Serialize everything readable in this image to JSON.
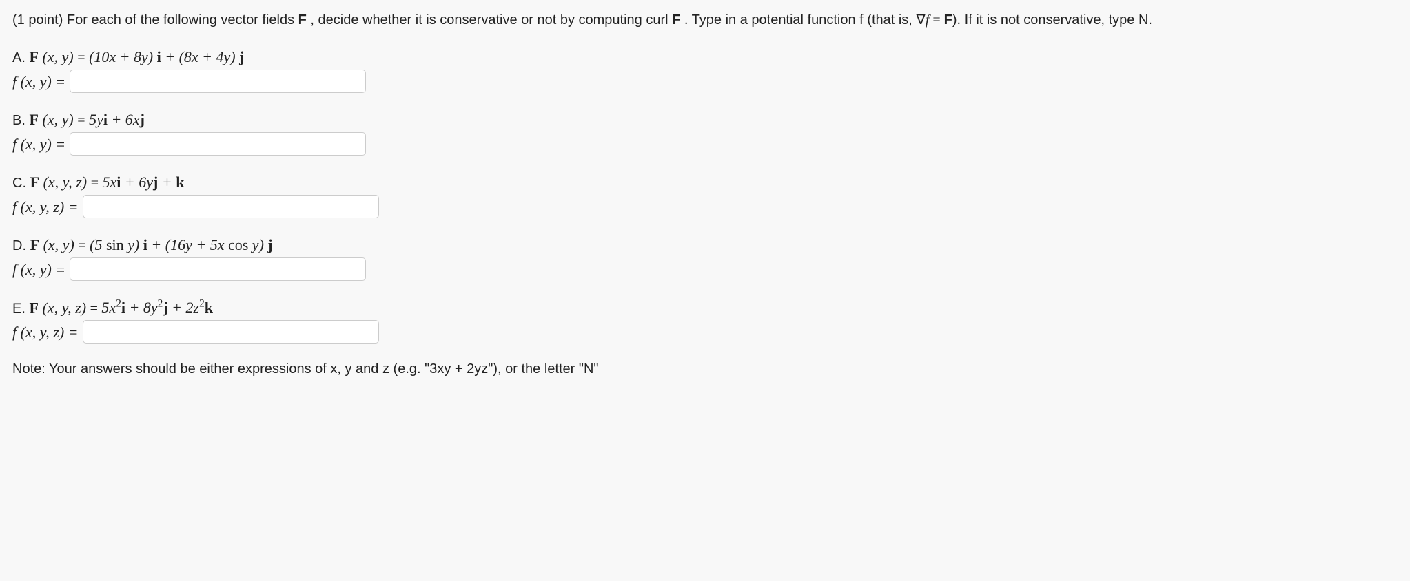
{
  "intro": {
    "p1": "(1 point) For each of the following vector fields ",
    "F": "F",
    "p2": " , decide whether it is conservative or not by computing curl ",
    "F2": "F",
    "p3": " . Type in a potential function f (that is, ",
    "grad": "∇",
    "f": "f",
    "eq": " = ",
    "F3": "F",
    "p4": "). If it is not conservative, type N."
  },
  "parts": {
    "a": {
      "letter": "A. ",
      "lhs": "F (x, y) = ",
      "rhs": "(10x + 8y) i + (8x + 4y) j",
      "flabel": "f (x, y) ="
    },
    "b": {
      "letter": "B. ",
      "lhs": "F (x, y) = ",
      "rhs": "5yi + 6xj",
      "flabel": "f (x, y) ="
    },
    "c": {
      "letter": "C. ",
      "lhs": "F (x, y, z) = ",
      "rhs": "5xi + 6yj + k",
      "flabel": "f (x, y, z) ="
    },
    "d": {
      "letter": "D. ",
      "lhs": "F (x, y) = ",
      "rhs": "(5 sin y) i + (16y + 5x cos y) j",
      "flabel": "f (x, y) ="
    },
    "e": {
      "letter": "E. ",
      "lhs": "F (x, y, z) = ",
      "rhs": "5x²i + 8y²j + 2z²k",
      "flabel": "f (x, y, z) ="
    }
  },
  "note": "Note: Your answers should be either expressions of x, y and z (e.g. \"3xy + 2yz\"), or the letter \"N\""
}
